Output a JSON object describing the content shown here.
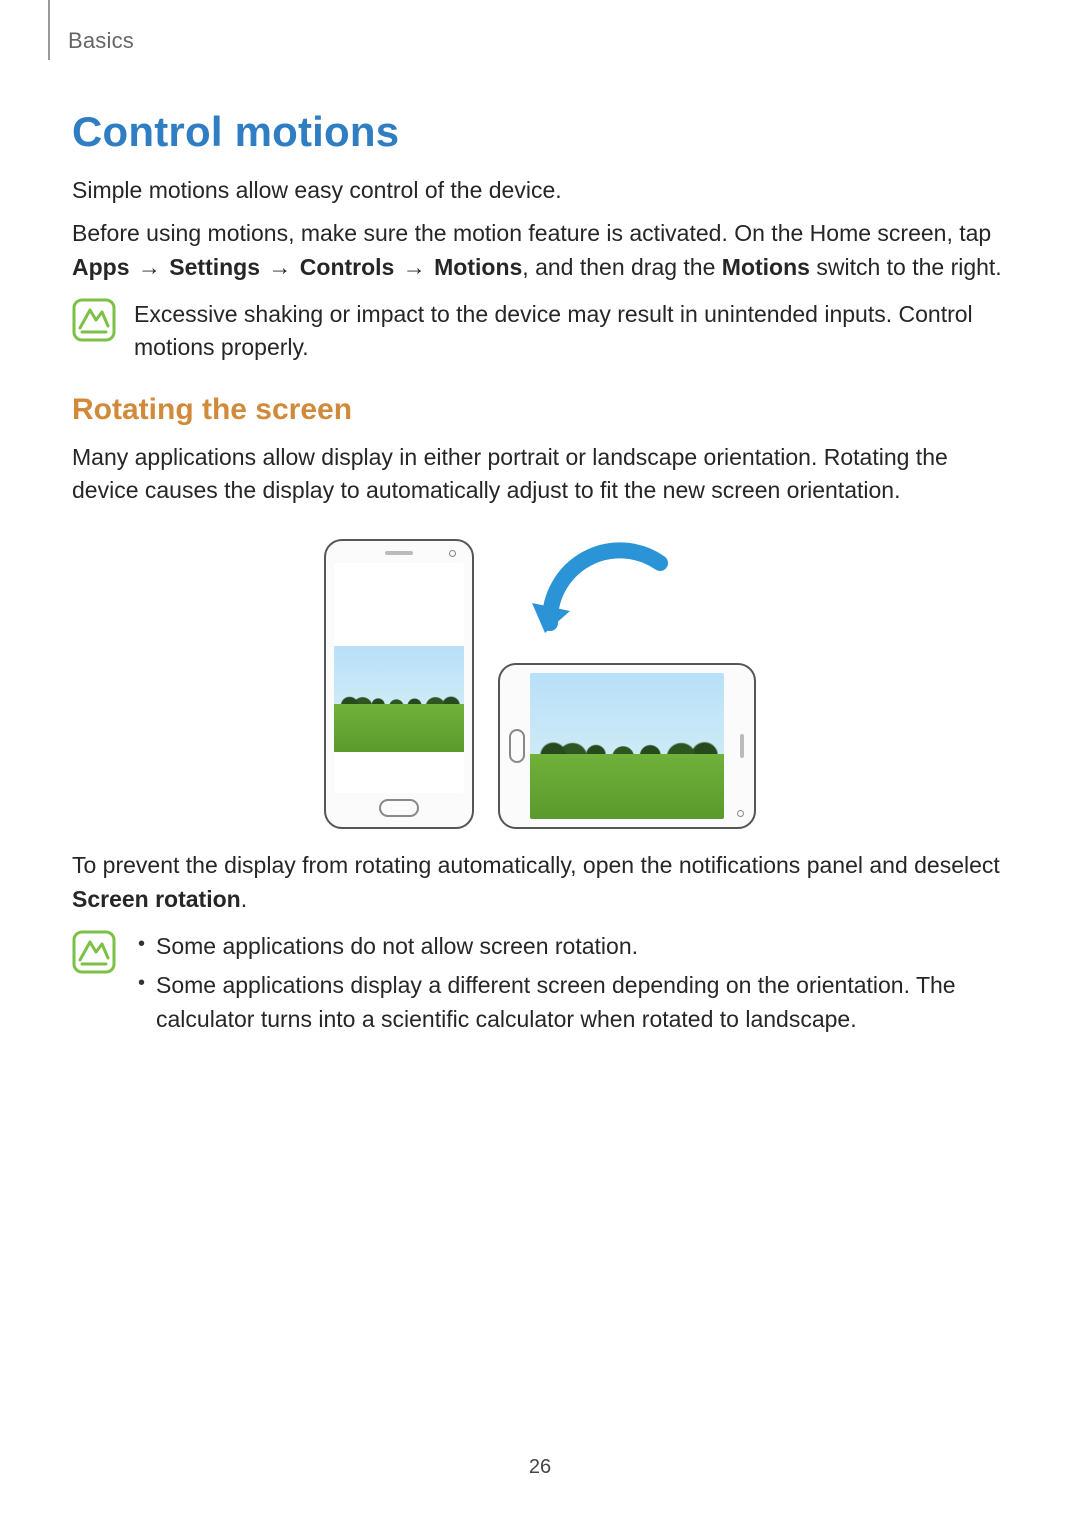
{
  "section_label": "Basics",
  "title": "Control motions",
  "intro1": "Simple motions allow easy control of the device.",
  "intro2_pre": "Before using motions, make sure the motion feature is activated. On the Home screen, tap ",
  "path": {
    "apps": "Apps",
    "settings": "Settings",
    "controls": "Controls",
    "motions": "Motions"
  },
  "arrow": "→",
  "intro2_mid": ", and then drag the ",
  "intro2_bold_switch": "Motions",
  "intro2_end": " switch to the right.",
  "note1": "Excessive shaking or impact to the device may result in unintended inputs. Control motions properly.",
  "sub_heading": "Rotating the screen",
  "rotate_p": "Many applications allow display in either portrait or landscape orientation. Rotating the device causes the display to automatically adjust to fit the new screen orientation.",
  "prevent_pre": "To prevent the display from rotating automatically, open the notifications panel and deselect ",
  "prevent_bold": "Screen rotation",
  "prevent_end": ".",
  "note2_bullets": [
    "Some applications do not allow screen rotation.",
    "Some applications display a different screen depending on the orientation. The calculator turns into a scientific calculator when rotated to landscape."
  ],
  "page_number": "26"
}
